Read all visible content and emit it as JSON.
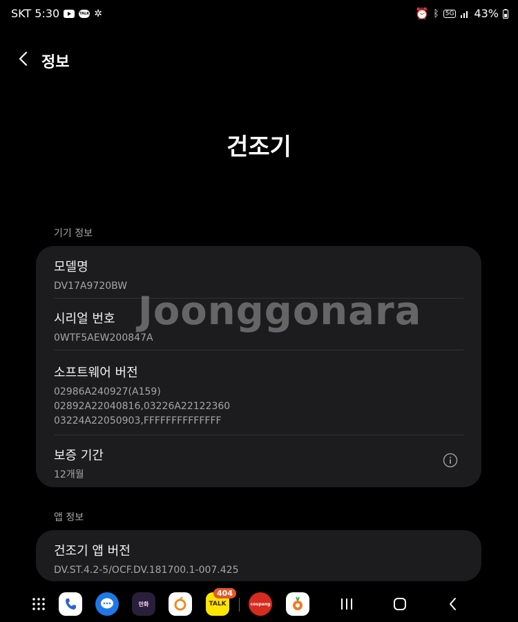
{
  "status_bar": {
    "carrier_time": "SKT 5:30",
    "battery": "43%",
    "network": "5G"
  },
  "header": {
    "title": "정보"
  },
  "hero": {
    "title": "건조기"
  },
  "device_section": {
    "label": "기기 정보",
    "model": {
      "title": "모델명",
      "value": "DV17A9720BW"
    },
    "serial": {
      "title": "시리얼 번호",
      "value": "0WTF5AEW200847A"
    },
    "software": {
      "title": "소프트웨어 버전",
      "lines": [
        "02986A240927(A159)",
        "02892A22040816,03226A22122360",
        "03224A22050903,FFFFFFFFFFFFFF"
      ]
    },
    "warranty": {
      "title": "보증 기간",
      "value": "12개월"
    }
  },
  "app_section": {
    "label": "앱 정보",
    "version": {
      "title": "건조기 앱 버전",
      "value": "DV.ST.4.2-5/OCF.DV.181700.1-007.425"
    }
  },
  "watermark": "Joonggonara",
  "dock": {
    "kakaotalk_badge": "404",
    "apps": [
      "apps-grid-icon",
      "phone-icon",
      "messages-icon",
      "webtoon-icon",
      "cashwalk-icon",
      "kakaotalk-icon",
      "coupang-icon",
      "daangn-icon"
    ],
    "talk_label": "TALK",
    "coupang_label": "coupang"
  }
}
